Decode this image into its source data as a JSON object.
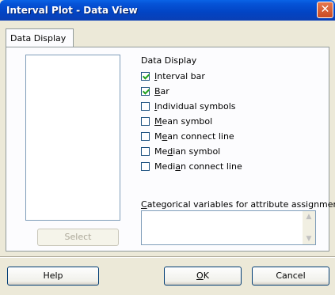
{
  "window": {
    "title": "Interval Plot - Data View",
    "close_glyph": "✕"
  },
  "tabs": [
    {
      "label": "Data Display"
    }
  ],
  "left": {
    "select_label": "Select"
  },
  "data_display": {
    "label": "Data Display",
    "options": [
      {
        "pre": "",
        "u": "I",
        "post": "nterval bar",
        "checked": true
      },
      {
        "pre": "",
        "u": "B",
        "post": "ar",
        "checked": true
      },
      {
        "pre": "",
        "u": "I",
        "post": "ndividual symbols",
        "checked": false
      },
      {
        "pre": "",
        "u": "M",
        "post": "ean symbol",
        "checked": false
      },
      {
        "pre": "M",
        "u": "e",
        "post": "an connect line",
        "checked": false
      },
      {
        "pre": "Me",
        "u": "d",
        "post": "ian symbol",
        "checked": false
      },
      {
        "pre": "Medi",
        "u": "a",
        "post": "n connect line",
        "checked": false
      }
    ]
  },
  "categorical": {
    "pre": "",
    "u": "C",
    "post": "ategorical variables for attribute assignment:"
  },
  "buttons": {
    "help": "Help",
    "ok_u": "O",
    "ok_post": "K",
    "cancel": "Cancel"
  }
}
